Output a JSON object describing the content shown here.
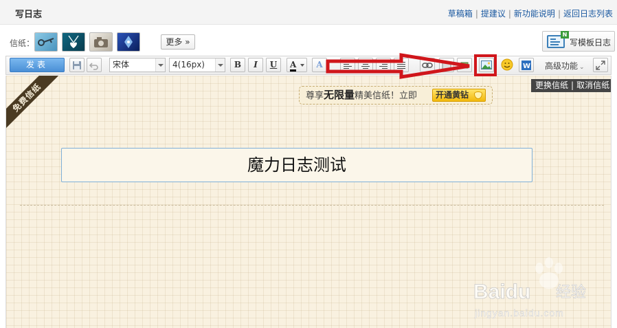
{
  "header": {
    "title": "写日志",
    "links": [
      "草稿箱",
      "提建议",
      "新功能说明",
      "返回日志列表"
    ],
    "separator": "|"
  },
  "stationery": {
    "label": "信纸：",
    "thumbs": [
      {
        "name": "stationery-thumb-1",
        "color": "#6fb2d6"
      },
      {
        "name": "stationery-thumb-2",
        "color": "#0e5a73"
      },
      {
        "name": "stationery-thumb-3",
        "color": "#d8d3c8"
      },
      {
        "name": "stationery-thumb-4",
        "color": "#1b3b8e"
      }
    ],
    "more_label": "更多",
    "more_glyph": "»",
    "template_button": "写模板日志",
    "template_badge": "N"
  },
  "toolbar": {
    "publish_label": "发表",
    "font_family": "宋体",
    "font_size": "4(16px)",
    "bold": "B",
    "italic": "I",
    "underline": "U",
    "font_color_glyph": "A",
    "font_bg_glyph": "A",
    "advanced_label": "高级功能",
    "advanced_caret": "⌄"
  },
  "editor": {
    "ribbon_text": "免费信纸",
    "change_stationery": "更换信纸",
    "cancel_stationery": "取消信纸",
    "change_sep": "|",
    "promo_prefix": "尊享",
    "promo_strong": "无限量",
    "promo_suffix": "精美信纸！立即",
    "promo_button": "开通黄钻",
    "title_value": "魔力日志测试"
  },
  "watermark": {
    "brand": "Baidu",
    "sub": "经验",
    "url": "jingyan.baidu.com"
  },
  "colors": {
    "annotation_red": "#d0161b",
    "link_blue": "#1a58a0",
    "publish_blue": "#4a8fd6"
  }
}
